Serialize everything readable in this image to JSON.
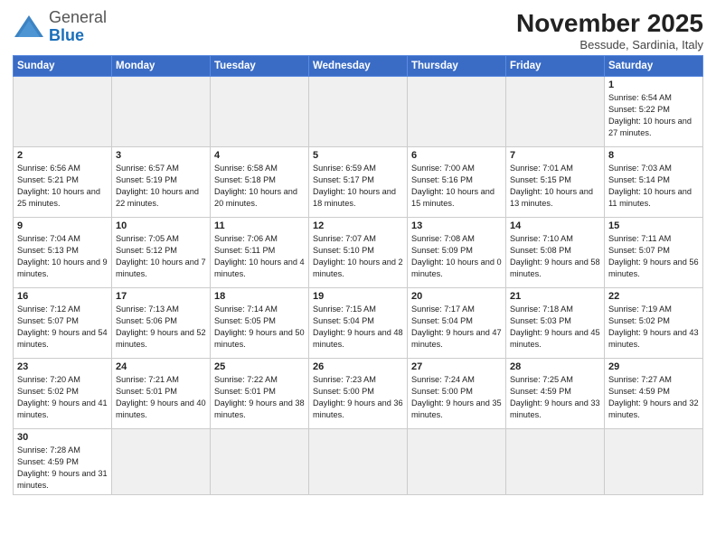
{
  "header": {
    "logo_general": "General",
    "logo_blue": "Blue",
    "month_title": "November 2025",
    "location": "Bessude, Sardinia, Italy"
  },
  "days_of_week": [
    "Sunday",
    "Monday",
    "Tuesday",
    "Wednesday",
    "Thursday",
    "Friday",
    "Saturday"
  ],
  "weeks": [
    [
      {
        "day": "",
        "info": "",
        "empty": true
      },
      {
        "day": "",
        "info": "",
        "empty": true
      },
      {
        "day": "",
        "info": "",
        "empty": true
      },
      {
        "day": "",
        "info": "",
        "empty": true
      },
      {
        "day": "",
        "info": "",
        "empty": true
      },
      {
        "day": "",
        "info": "",
        "empty": true
      },
      {
        "day": "1",
        "info": "Sunrise: 6:54 AM\nSunset: 5:22 PM\nDaylight: 10 hours and 27 minutes."
      }
    ],
    [
      {
        "day": "2",
        "info": "Sunrise: 6:56 AM\nSunset: 5:21 PM\nDaylight: 10 hours and 25 minutes."
      },
      {
        "day": "3",
        "info": "Sunrise: 6:57 AM\nSunset: 5:19 PM\nDaylight: 10 hours and 22 minutes."
      },
      {
        "day": "4",
        "info": "Sunrise: 6:58 AM\nSunset: 5:18 PM\nDaylight: 10 hours and 20 minutes."
      },
      {
        "day": "5",
        "info": "Sunrise: 6:59 AM\nSunset: 5:17 PM\nDaylight: 10 hours and 18 minutes."
      },
      {
        "day": "6",
        "info": "Sunrise: 7:00 AM\nSunset: 5:16 PM\nDaylight: 10 hours and 15 minutes."
      },
      {
        "day": "7",
        "info": "Sunrise: 7:01 AM\nSunset: 5:15 PM\nDaylight: 10 hours and 13 minutes."
      },
      {
        "day": "8",
        "info": "Sunrise: 7:03 AM\nSunset: 5:14 PM\nDaylight: 10 hours and 11 minutes."
      }
    ],
    [
      {
        "day": "9",
        "info": "Sunrise: 7:04 AM\nSunset: 5:13 PM\nDaylight: 10 hours and 9 minutes."
      },
      {
        "day": "10",
        "info": "Sunrise: 7:05 AM\nSunset: 5:12 PM\nDaylight: 10 hours and 7 minutes."
      },
      {
        "day": "11",
        "info": "Sunrise: 7:06 AM\nSunset: 5:11 PM\nDaylight: 10 hours and 4 minutes."
      },
      {
        "day": "12",
        "info": "Sunrise: 7:07 AM\nSunset: 5:10 PM\nDaylight: 10 hours and 2 minutes."
      },
      {
        "day": "13",
        "info": "Sunrise: 7:08 AM\nSunset: 5:09 PM\nDaylight: 10 hours and 0 minutes."
      },
      {
        "day": "14",
        "info": "Sunrise: 7:10 AM\nSunset: 5:08 PM\nDaylight: 9 hours and 58 minutes."
      },
      {
        "day": "15",
        "info": "Sunrise: 7:11 AM\nSunset: 5:07 PM\nDaylight: 9 hours and 56 minutes."
      }
    ],
    [
      {
        "day": "16",
        "info": "Sunrise: 7:12 AM\nSunset: 5:07 PM\nDaylight: 9 hours and 54 minutes."
      },
      {
        "day": "17",
        "info": "Sunrise: 7:13 AM\nSunset: 5:06 PM\nDaylight: 9 hours and 52 minutes."
      },
      {
        "day": "18",
        "info": "Sunrise: 7:14 AM\nSunset: 5:05 PM\nDaylight: 9 hours and 50 minutes."
      },
      {
        "day": "19",
        "info": "Sunrise: 7:15 AM\nSunset: 5:04 PM\nDaylight: 9 hours and 48 minutes."
      },
      {
        "day": "20",
        "info": "Sunrise: 7:17 AM\nSunset: 5:04 PM\nDaylight: 9 hours and 47 minutes."
      },
      {
        "day": "21",
        "info": "Sunrise: 7:18 AM\nSunset: 5:03 PM\nDaylight: 9 hours and 45 minutes."
      },
      {
        "day": "22",
        "info": "Sunrise: 7:19 AM\nSunset: 5:02 PM\nDaylight: 9 hours and 43 minutes."
      }
    ],
    [
      {
        "day": "23",
        "info": "Sunrise: 7:20 AM\nSunset: 5:02 PM\nDaylight: 9 hours and 41 minutes."
      },
      {
        "day": "24",
        "info": "Sunrise: 7:21 AM\nSunset: 5:01 PM\nDaylight: 9 hours and 40 minutes."
      },
      {
        "day": "25",
        "info": "Sunrise: 7:22 AM\nSunset: 5:01 PM\nDaylight: 9 hours and 38 minutes."
      },
      {
        "day": "26",
        "info": "Sunrise: 7:23 AM\nSunset: 5:00 PM\nDaylight: 9 hours and 36 minutes."
      },
      {
        "day": "27",
        "info": "Sunrise: 7:24 AM\nSunset: 5:00 PM\nDaylight: 9 hours and 35 minutes."
      },
      {
        "day": "28",
        "info": "Sunrise: 7:25 AM\nSunset: 4:59 PM\nDaylight: 9 hours and 33 minutes."
      },
      {
        "day": "29",
        "info": "Sunrise: 7:27 AM\nSunset: 4:59 PM\nDaylight: 9 hours and 32 minutes."
      }
    ],
    [
      {
        "day": "30",
        "info": "Sunrise: 7:28 AM\nSunset: 4:59 PM\nDaylight: 9 hours and 31 minutes."
      },
      {
        "day": "",
        "info": "",
        "empty": true
      },
      {
        "day": "",
        "info": "",
        "empty": true
      },
      {
        "day": "",
        "info": "",
        "empty": true
      },
      {
        "day": "",
        "info": "",
        "empty": true
      },
      {
        "day": "",
        "info": "",
        "empty": true
      },
      {
        "day": "",
        "info": "",
        "empty": true
      }
    ]
  ]
}
